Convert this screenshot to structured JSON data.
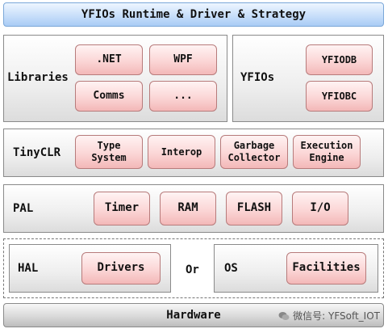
{
  "title": "YFIOs Runtime & Driver & Strategy",
  "libraries": {
    "label": "Libraries",
    "items": [
      ".NET",
      "WPF",
      "Comms",
      "..."
    ]
  },
  "yfios": {
    "label": "YFIOs",
    "items": [
      "YFIODB",
      "YFIOBC"
    ]
  },
  "tinyclr": {
    "label": "TinyCLR",
    "items": [
      {
        "line1": "Type",
        "line2": "System"
      },
      {
        "line1": "Interop",
        "line2": ""
      },
      {
        "line1": "Garbage",
        "line2": "Collector"
      },
      {
        "line1": "Execution",
        "line2": "Engine"
      }
    ]
  },
  "pal": {
    "label": "PAL",
    "items": [
      "Timer",
      "RAM",
      "FLASH",
      "I/O"
    ]
  },
  "hal": {
    "label": "HAL",
    "item": "Drivers"
  },
  "or_label": "Or",
  "os": {
    "label": "OS",
    "item": "Facilities"
  },
  "hardware": "Hardware",
  "watermark": "微信号: YFSoft_IOT",
  "colors": {
    "title_bg": "#a9ccf5",
    "box_pink": "#f3b8b8",
    "layer_gray": "#dcdcdc"
  }
}
